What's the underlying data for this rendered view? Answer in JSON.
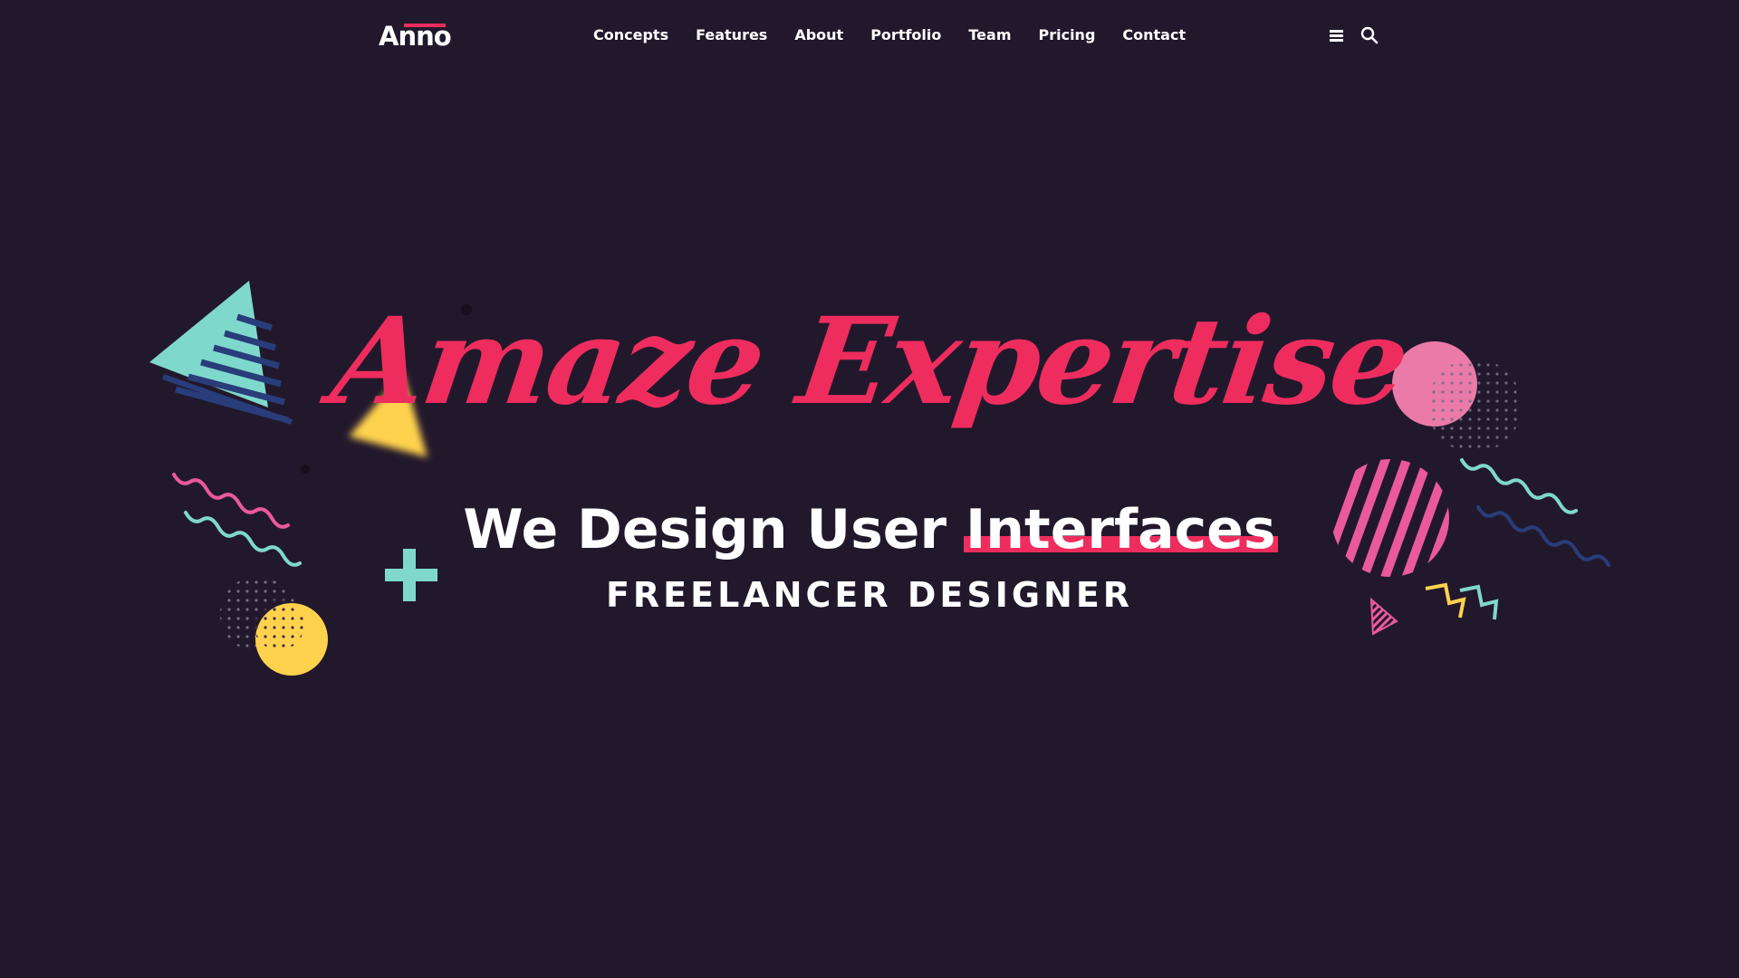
{
  "header": {
    "logo_text": "Anno",
    "nav": [
      {
        "label": "Concepts"
      },
      {
        "label": "Features"
      },
      {
        "label": "About"
      },
      {
        "label": "Portfolio"
      },
      {
        "label": "Team"
      },
      {
        "label": "Pricing"
      },
      {
        "label": "Contact"
      }
    ],
    "icons": [
      "menu-icon",
      "search-icon"
    ]
  },
  "hero": {
    "script_title": "Amaze Expertise",
    "headline_prefix": "We Design User",
    "headline_highlight": "Interfaces",
    "subline": "FREELANCER DESIGNER"
  },
  "colors": {
    "background": "#22182c",
    "accent": "#ee2d5e",
    "teal": "#7fd8cc",
    "yellow": "#ffd24d",
    "pink": "#ea7ba9",
    "navy": "#283d7a",
    "text": "#ffffff"
  }
}
